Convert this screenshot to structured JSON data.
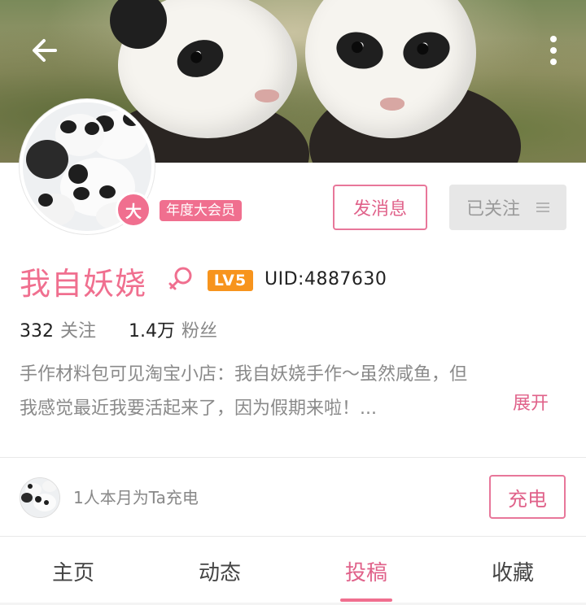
{
  "header": {
    "back_icon": "arrow-left-icon",
    "more_icon": "more-vertical-icon"
  },
  "profile": {
    "vip_badge_char": "大",
    "vip_tag": "年度大会员",
    "message_button": "发消息",
    "follow_button": "已关注",
    "follow_menu_icon": "menu-lines-icon",
    "name": "我自妖娆",
    "gender_icon": "female-icon",
    "level": "LV5",
    "uid": "UID:4887630",
    "following_count": "332",
    "following_label": "关注",
    "fans_count": "1.4万",
    "fans_label": "粉丝",
    "bio_line1": "手作材料包可见淘宝小店：我自妖娆手作～虽然咸鱼，但",
    "bio_line2": "我感觉最近我要活起来了，因为假期来啦！...",
    "expand": "展开"
  },
  "charge": {
    "text": "1人本月为Ta充电",
    "button": "充电"
  },
  "tabs": [
    {
      "label": "主页"
    },
    {
      "label": "动态"
    },
    {
      "label": "投稿"
    },
    {
      "label": "收藏"
    }
  ],
  "colors": {
    "accent": "#f06f8f",
    "level": "#f7941d",
    "muted": "#8a8a8a"
  }
}
